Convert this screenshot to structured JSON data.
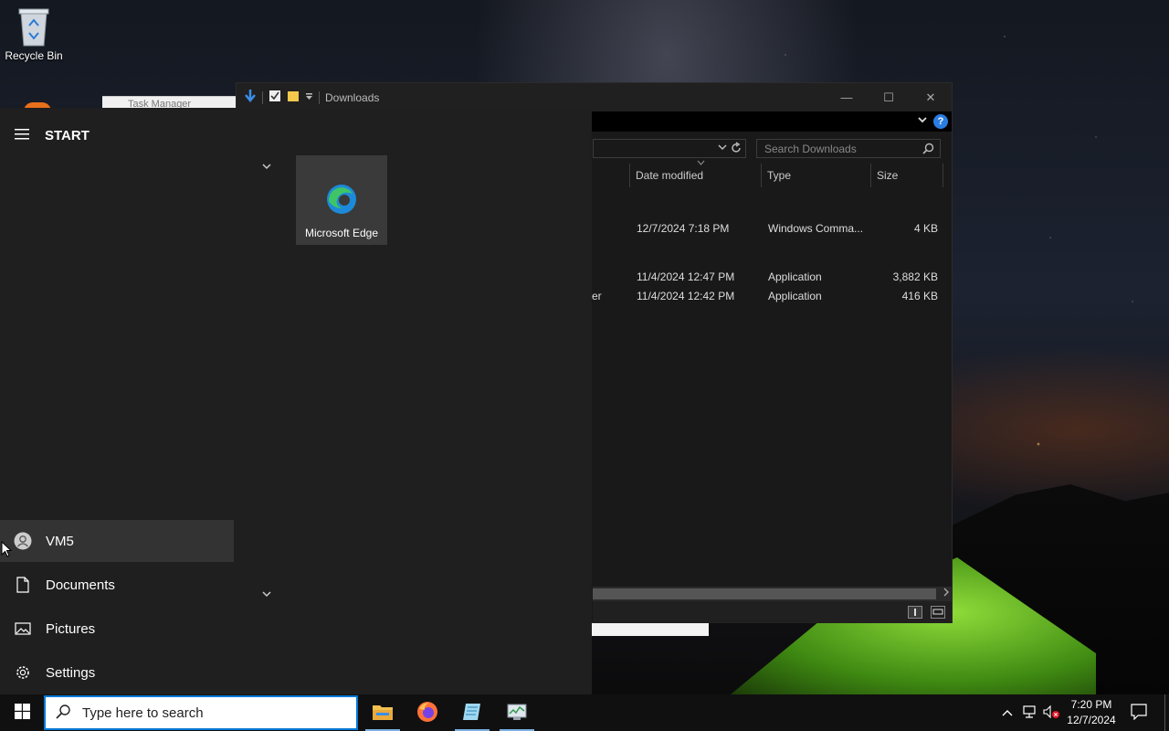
{
  "desktop": {
    "recycle_bin_label": "Recycle Bin",
    "peek_task_label": "Task Manager"
  },
  "explorer": {
    "title": "Downloads",
    "search_placeholder": "Search Downloads",
    "help_glyph": "?",
    "controls": {
      "minimize": "—",
      "maximize": "☐",
      "close": "✕"
    },
    "columns": {
      "date_modified": "Date modified",
      "type": "Type",
      "size": "Size"
    },
    "rows": [
      {
        "date": "12/7/2024 7:18 PM",
        "type": "Windows Comma...",
        "size": "4 KB"
      },
      {
        "date": "11/4/2024 12:47 PM",
        "type": "Application",
        "size": "3,882 KB"
      },
      {
        "date": "11/4/2024 12:42 PM",
        "type": "Application",
        "size": "416 KB"
      }
    ],
    "truncated_name_tail": "er"
  },
  "start_menu": {
    "header": "START",
    "user": "VM5",
    "items": [
      {
        "label": "Documents",
        "icon": "document-icon"
      },
      {
        "label": "Pictures",
        "icon": "pictures-icon"
      },
      {
        "label": "Settings",
        "icon": "gear-icon"
      }
    ],
    "tile": {
      "label": "Microsoft Edge",
      "icon": "edge-icon"
    }
  },
  "taskbar": {
    "search_placeholder": "Type here to search",
    "time": "7:20 PM",
    "date": "12/7/2024",
    "accent": "#0078d7"
  }
}
